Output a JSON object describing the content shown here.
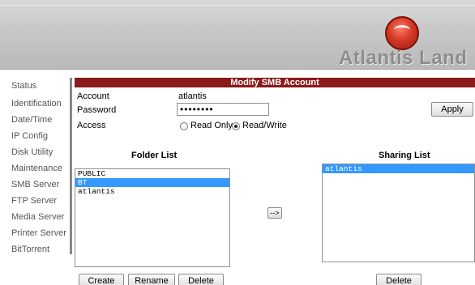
{
  "brand": {
    "name": "Atlantis Land"
  },
  "sidebar": {
    "items": [
      {
        "label": "Status"
      },
      {
        "label": "Identification"
      },
      {
        "label": "Date/Time"
      },
      {
        "label": "IP Config"
      },
      {
        "label": "Disk Utility"
      },
      {
        "label": "Maintenance"
      },
      {
        "label": "SMB Server"
      },
      {
        "label": "FTP Server"
      },
      {
        "label": "Media Server"
      },
      {
        "label": "Printer Server"
      },
      {
        "label": "BitTorrent"
      }
    ]
  },
  "form": {
    "title": "Modify SMB Account",
    "account_label": "Account",
    "account_value": "atlantis",
    "password_label": "Password",
    "password_value": "••••••••",
    "access_label": "Access",
    "access_options": [
      {
        "label": "Read Only",
        "selected": false
      },
      {
        "label": "Read/Write",
        "selected": true
      }
    ],
    "apply_label": "Apply"
  },
  "folder_list": {
    "title": "Folder List",
    "items": [
      {
        "label": "PUBLIC",
        "selected": false
      },
      {
        "label": "BT",
        "selected": true
      },
      {
        "label": "atlantis",
        "selected": false
      }
    ],
    "create_label": "Create",
    "rename_label": "Rename",
    "delete_label": "Delete"
  },
  "transfer": {
    "label": "-->"
  },
  "sharing_list": {
    "title": "Sharing List",
    "items": [
      {
        "label": "atlantis",
        "selected": true
      }
    ],
    "delete_label": "Delete"
  },
  "colors": {
    "header_bar": "#8b1a1a",
    "selection": "#3399ff",
    "logo_red": "#d43a25"
  }
}
